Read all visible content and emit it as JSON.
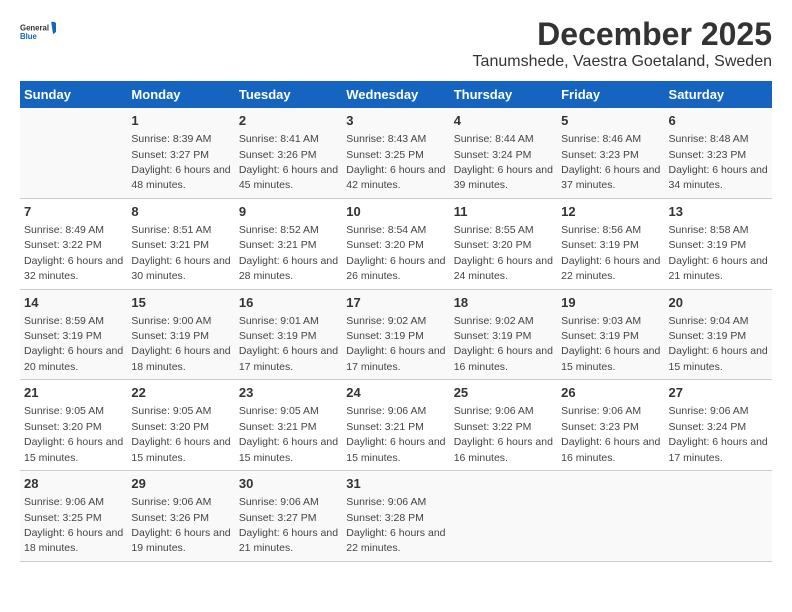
{
  "logo": {
    "general": "General",
    "blue": "Blue"
  },
  "title": "December 2025",
  "subtitle": "Tanumshede, Vaestra Goetaland, Sweden",
  "headers": [
    "Sunday",
    "Monday",
    "Tuesday",
    "Wednesday",
    "Thursday",
    "Friday",
    "Saturday"
  ],
  "weeks": [
    [
      {
        "day": "",
        "sunrise": "",
        "sunset": "",
        "daylight": ""
      },
      {
        "day": "1",
        "sunrise": "Sunrise: 8:39 AM",
        "sunset": "Sunset: 3:27 PM",
        "daylight": "Daylight: 6 hours and 48 minutes."
      },
      {
        "day": "2",
        "sunrise": "Sunrise: 8:41 AM",
        "sunset": "Sunset: 3:26 PM",
        "daylight": "Daylight: 6 hours and 45 minutes."
      },
      {
        "day": "3",
        "sunrise": "Sunrise: 8:43 AM",
        "sunset": "Sunset: 3:25 PM",
        "daylight": "Daylight: 6 hours and 42 minutes."
      },
      {
        "day": "4",
        "sunrise": "Sunrise: 8:44 AM",
        "sunset": "Sunset: 3:24 PM",
        "daylight": "Daylight: 6 hours and 39 minutes."
      },
      {
        "day": "5",
        "sunrise": "Sunrise: 8:46 AM",
        "sunset": "Sunset: 3:23 PM",
        "daylight": "Daylight: 6 hours and 37 minutes."
      },
      {
        "day": "6",
        "sunrise": "Sunrise: 8:48 AM",
        "sunset": "Sunset: 3:23 PM",
        "daylight": "Daylight: 6 hours and 34 minutes."
      }
    ],
    [
      {
        "day": "7",
        "sunrise": "Sunrise: 8:49 AM",
        "sunset": "Sunset: 3:22 PM",
        "daylight": "Daylight: 6 hours and 32 minutes."
      },
      {
        "day": "8",
        "sunrise": "Sunrise: 8:51 AM",
        "sunset": "Sunset: 3:21 PM",
        "daylight": "Daylight: 6 hours and 30 minutes."
      },
      {
        "day": "9",
        "sunrise": "Sunrise: 8:52 AM",
        "sunset": "Sunset: 3:21 PM",
        "daylight": "Daylight: 6 hours and 28 minutes."
      },
      {
        "day": "10",
        "sunrise": "Sunrise: 8:54 AM",
        "sunset": "Sunset: 3:20 PM",
        "daylight": "Daylight: 6 hours and 26 minutes."
      },
      {
        "day": "11",
        "sunrise": "Sunrise: 8:55 AM",
        "sunset": "Sunset: 3:20 PM",
        "daylight": "Daylight: 6 hours and 24 minutes."
      },
      {
        "day": "12",
        "sunrise": "Sunrise: 8:56 AM",
        "sunset": "Sunset: 3:19 PM",
        "daylight": "Daylight: 6 hours and 22 minutes."
      },
      {
        "day": "13",
        "sunrise": "Sunrise: 8:58 AM",
        "sunset": "Sunset: 3:19 PM",
        "daylight": "Daylight: 6 hours and 21 minutes."
      }
    ],
    [
      {
        "day": "14",
        "sunrise": "Sunrise: 8:59 AM",
        "sunset": "Sunset: 3:19 PM",
        "daylight": "Daylight: 6 hours and 20 minutes."
      },
      {
        "day": "15",
        "sunrise": "Sunrise: 9:00 AM",
        "sunset": "Sunset: 3:19 PM",
        "daylight": "Daylight: 6 hours and 18 minutes."
      },
      {
        "day": "16",
        "sunrise": "Sunrise: 9:01 AM",
        "sunset": "Sunset: 3:19 PM",
        "daylight": "Daylight: 6 hours and 17 minutes."
      },
      {
        "day": "17",
        "sunrise": "Sunrise: 9:02 AM",
        "sunset": "Sunset: 3:19 PM",
        "daylight": "Daylight: 6 hours and 17 minutes."
      },
      {
        "day": "18",
        "sunrise": "Sunrise: 9:02 AM",
        "sunset": "Sunset: 3:19 PM",
        "daylight": "Daylight: 6 hours and 16 minutes."
      },
      {
        "day": "19",
        "sunrise": "Sunrise: 9:03 AM",
        "sunset": "Sunset: 3:19 PM",
        "daylight": "Daylight: 6 hours and 15 minutes."
      },
      {
        "day": "20",
        "sunrise": "Sunrise: 9:04 AM",
        "sunset": "Sunset: 3:19 PM",
        "daylight": "Daylight: 6 hours and 15 minutes."
      }
    ],
    [
      {
        "day": "21",
        "sunrise": "Sunrise: 9:05 AM",
        "sunset": "Sunset: 3:20 PM",
        "daylight": "Daylight: 6 hours and 15 minutes."
      },
      {
        "day": "22",
        "sunrise": "Sunrise: 9:05 AM",
        "sunset": "Sunset: 3:20 PM",
        "daylight": "Daylight: 6 hours and 15 minutes."
      },
      {
        "day": "23",
        "sunrise": "Sunrise: 9:05 AM",
        "sunset": "Sunset: 3:21 PM",
        "daylight": "Daylight: 6 hours and 15 minutes."
      },
      {
        "day": "24",
        "sunrise": "Sunrise: 9:06 AM",
        "sunset": "Sunset: 3:21 PM",
        "daylight": "Daylight: 6 hours and 15 minutes."
      },
      {
        "day": "25",
        "sunrise": "Sunrise: 9:06 AM",
        "sunset": "Sunset: 3:22 PM",
        "daylight": "Daylight: 6 hours and 16 minutes."
      },
      {
        "day": "26",
        "sunrise": "Sunrise: 9:06 AM",
        "sunset": "Sunset: 3:23 PM",
        "daylight": "Daylight: 6 hours and 16 minutes."
      },
      {
        "day": "27",
        "sunrise": "Sunrise: 9:06 AM",
        "sunset": "Sunset: 3:24 PM",
        "daylight": "Daylight: 6 hours and 17 minutes."
      }
    ],
    [
      {
        "day": "28",
        "sunrise": "Sunrise: 9:06 AM",
        "sunset": "Sunset: 3:25 PM",
        "daylight": "Daylight: 6 hours and 18 minutes."
      },
      {
        "day": "29",
        "sunrise": "Sunrise: 9:06 AM",
        "sunset": "Sunset: 3:26 PM",
        "daylight": "Daylight: 6 hours and 19 minutes."
      },
      {
        "day": "30",
        "sunrise": "Sunrise: 9:06 AM",
        "sunset": "Sunset: 3:27 PM",
        "daylight": "Daylight: 6 hours and 21 minutes."
      },
      {
        "day": "31",
        "sunrise": "Sunrise: 9:06 AM",
        "sunset": "Sunset: 3:28 PM",
        "daylight": "Daylight: 6 hours and 22 minutes."
      },
      {
        "day": "",
        "sunrise": "",
        "sunset": "",
        "daylight": ""
      },
      {
        "day": "",
        "sunrise": "",
        "sunset": "",
        "daylight": ""
      },
      {
        "day": "",
        "sunrise": "",
        "sunset": "",
        "daylight": ""
      }
    ]
  ]
}
